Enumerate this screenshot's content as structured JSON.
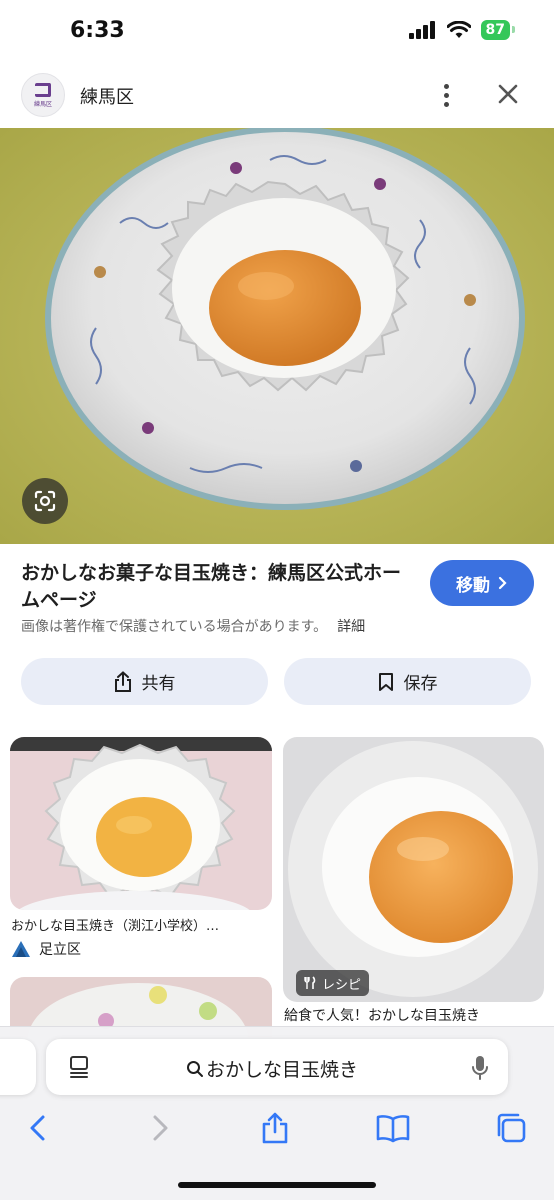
{
  "status_bar": {
    "time": "6:33",
    "battery": "87"
  },
  "site": {
    "name": "練馬区",
    "logo_icon": "nerima-logo-icon",
    "logo_text": "練馬区"
  },
  "result": {
    "title": "おかしなお菓子な目玉焼き：練馬区公式ホームページ",
    "copyright_note": "画像は著作権で保護されている場合があります。",
    "details_link": "詳細",
    "visit_button": "移動",
    "share_button": "共有",
    "save_button": "保存"
  },
  "related": [
    {
      "caption": "おかしな目玉焼き（渕江小学校）…",
      "source": "足立区",
      "source_icon": "adachi-logo-icon"
    },
    {
      "caption": "給食で人気！おかしな目玉焼き",
      "badge": "レシピ",
      "badge_icon": "fork-knife-icon"
    }
  ],
  "safari": {
    "address_text": "おかしな目玉焼き",
    "accent_color": "#3478f6"
  },
  "colors": {
    "visit_button": "#3b71e0",
    "pill_button": "#e9edf7",
    "battery": "#34c759"
  }
}
